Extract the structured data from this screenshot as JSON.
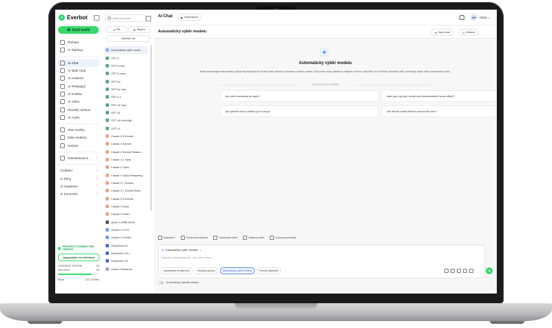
{
  "brand": {
    "name": "Everbot",
    "accent": "#39d86a"
  },
  "sidebar": {
    "start_label": "Začít tvořit",
    "items": [
      {
        "label": "Přehled",
        "icon": "home-icon"
      },
      {
        "label": "AI Šablony",
        "icon": "template-icon"
      },
      {
        "label": "AI Chat",
        "icon": "chat-icon",
        "active": true
      },
      {
        "label": "AI Multi Chat",
        "icon": "multichat-icon"
      },
      {
        "label": "AI Asistenti",
        "icon": "assistant-icon"
      },
      {
        "label": "AI Překladač",
        "icon": "translate-icon"
      },
      {
        "label": "AI Grafika",
        "icon": "image-icon"
      },
      {
        "label": "AI Video",
        "icon": "video-icon"
      },
      {
        "label": "Hloubký výzkum",
        "icon": "research-icon"
      },
      {
        "label": "AI Audio",
        "icon": "audio-icon"
      },
      {
        "label": "Hlas značky",
        "icon": "brand-voice-icon"
      },
      {
        "label": "Moje soubory",
        "icon": "folder-icon"
      },
      {
        "label": "Historie",
        "icon": "history-icon"
      },
      {
        "label": "Nainstalovat d...",
        "icon": "chrome-icon"
      }
    ],
    "groups": [
      "Vzdělání",
      "AI Dílny",
      "AI Akademie",
      "AI Komunita"
    ],
    "promo": "PŘEJDĚTE S EVERBOT BEZ OMEZENÍ",
    "upgrade": "Upgradujte na Unlimited",
    "usage": [
      {
        "label": "DOSAŽENÉ OMEZENÍ",
        "value": "2/8"
      },
      {
        "label": "ZÁKLADNÍ",
        "value": "0/3"
      }
    ],
    "usage_percent": 82,
    "credits_label": "Slova",
    "credits_value": "237 176 slov"
  },
  "models": {
    "search_placeholder": "Vyhledat model",
    "filter_label": "Filtr",
    "sort_label": "Řazení",
    "show_all": "Zobrazit vše",
    "items": [
      {
        "label": "Automatický výběr mode...",
        "color": "#8fb3f5",
        "active": true
      },
      {
        "label": "GPT-5",
        "color": "#5fa88a"
      },
      {
        "label": "GPT-5 mini",
        "color": "#5fa88a"
      },
      {
        "label": "GPT-5 nano",
        "color": "#5fa88a"
      },
      {
        "label": "GPT-4o",
        "color": "#5fa88a"
      },
      {
        "label": "GPT-4o mini",
        "color": "#5fa88a"
      },
      {
        "label": "GPT-4.1",
        "color": "#5fa88a"
      },
      {
        "label": "GPT o4-mini",
        "color": "#5fa88a"
      },
      {
        "label": "GPT o3",
        "color": "#5fa88a"
      },
      {
        "label": "GPT o3-mini-high",
        "color": "#5fa88a"
      },
      {
        "label": "GPT o1",
        "color": "#5fa88a"
      },
      {
        "label": "Claude 4.5 Sonnet",
        "color": "#e6a58a"
      },
      {
        "label": "Claude 4 Sonnet",
        "color": "#e6a58a"
      },
      {
        "label": "Claude 4 Sonnet Reason...",
        "color": "#e6a58a"
      },
      {
        "label": "Claude 4.1 Opus",
        "color": "#e6a58a"
      },
      {
        "label": "Claude 4 Opus",
        "color": "#e6a58a"
      },
      {
        "label": "Claude 4 Opus Reasoning",
        "color": "#e6a58a"
      },
      {
        "label": "Claude 3.7 Sonnet",
        "color": "#e6a58a"
      },
      {
        "label": "Claude 3.7 Sonnet Reas...",
        "color": "#e6a58a"
      },
      {
        "label": "Claude 3.5 Sonnet",
        "color": "#e6a58a"
      },
      {
        "label": "Claude 3 Opus",
        "color": "#e6a58a"
      },
      {
        "label": "Claude 3 Haiku",
        "color": "#e6a58a"
      },
      {
        "label": "Qwen 3 235B A22B",
        "color": "#555555"
      },
      {
        "label": "Gemini 2.5 Pro",
        "color": "#6fa0f0"
      },
      {
        "label": "Gemini 2.5 Flash",
        "color": "#6fa0f0"
      },
      {
        "label": "DeepSeek-R1",
        "color": "#4d6bd8"
      },
      {
        "label": "DeepSeek-V3.1",
        "color": "#4d6bd8"
      },
      {
        "label": "DeepSeek-V3",
        "color": "#4d6bd8"
      },
      {
        "label": "Llama 4 Maverick",
        "color": "#9aa9c9"
      }
    ]
  },
  "topbar": {
    "title": "AI Chat",
    "guide": "Videonávod",
    "user_initials": "KP",
    "user_name": "Klára"
  },
  "header": {
    "title": "Automatický výběr modelu",
    "new_chat": "Nový chat",
    "history": "Historie"
  },
  "hero": {
    "title": "Automatický výběr modelu",
    "desc": "Naše technologie automaticky vybírá nejvhodnější AI model podle obsahu a kontextu vašeho zadání. Díky tomu vždy získáte tu nejlepší možnou odpověď, ať už řešíte obchodní plán, technický dotaz nebo každodenní úkolu.",
    "suggest_label": "VYZKOUŠEJTE MODEL"
  },
  "suggestions": [
    "Jak začít investovat do akcií?",
    "Jaké jsou výhody i nevýhody dlouhodobého home office?",
    "Jak vytvořit silnou značku pro e-shop?",
    "Jak zdravě svačit během pracovního dne?"
  ],
  "tools": [
    "Nastavení",
    "Generovat obrázek",
    "Generovat video",
    "Hlasový režim",
    "Knihovna promptů"
  ],
  "composer": {
    "model": "Automatický výběr modelu",
    "placeholder": "Napište svůj požadavek, úkol nebo dotaz...",
    "options": [
      {
        "label": "Vyhledávat na internetu",
        "selected": false
      },
      {
        "label": "Hloubký výzkum",
        "selected": false
      },
      {
        "label": "Automatický výběr modelu",
        "selected": true
      },
      {
        "label": "Formát odpovědi",
        "selected": false
      }
    ]
  },
  "auto_improve": "Automaticky vylepšit zadání"
}
